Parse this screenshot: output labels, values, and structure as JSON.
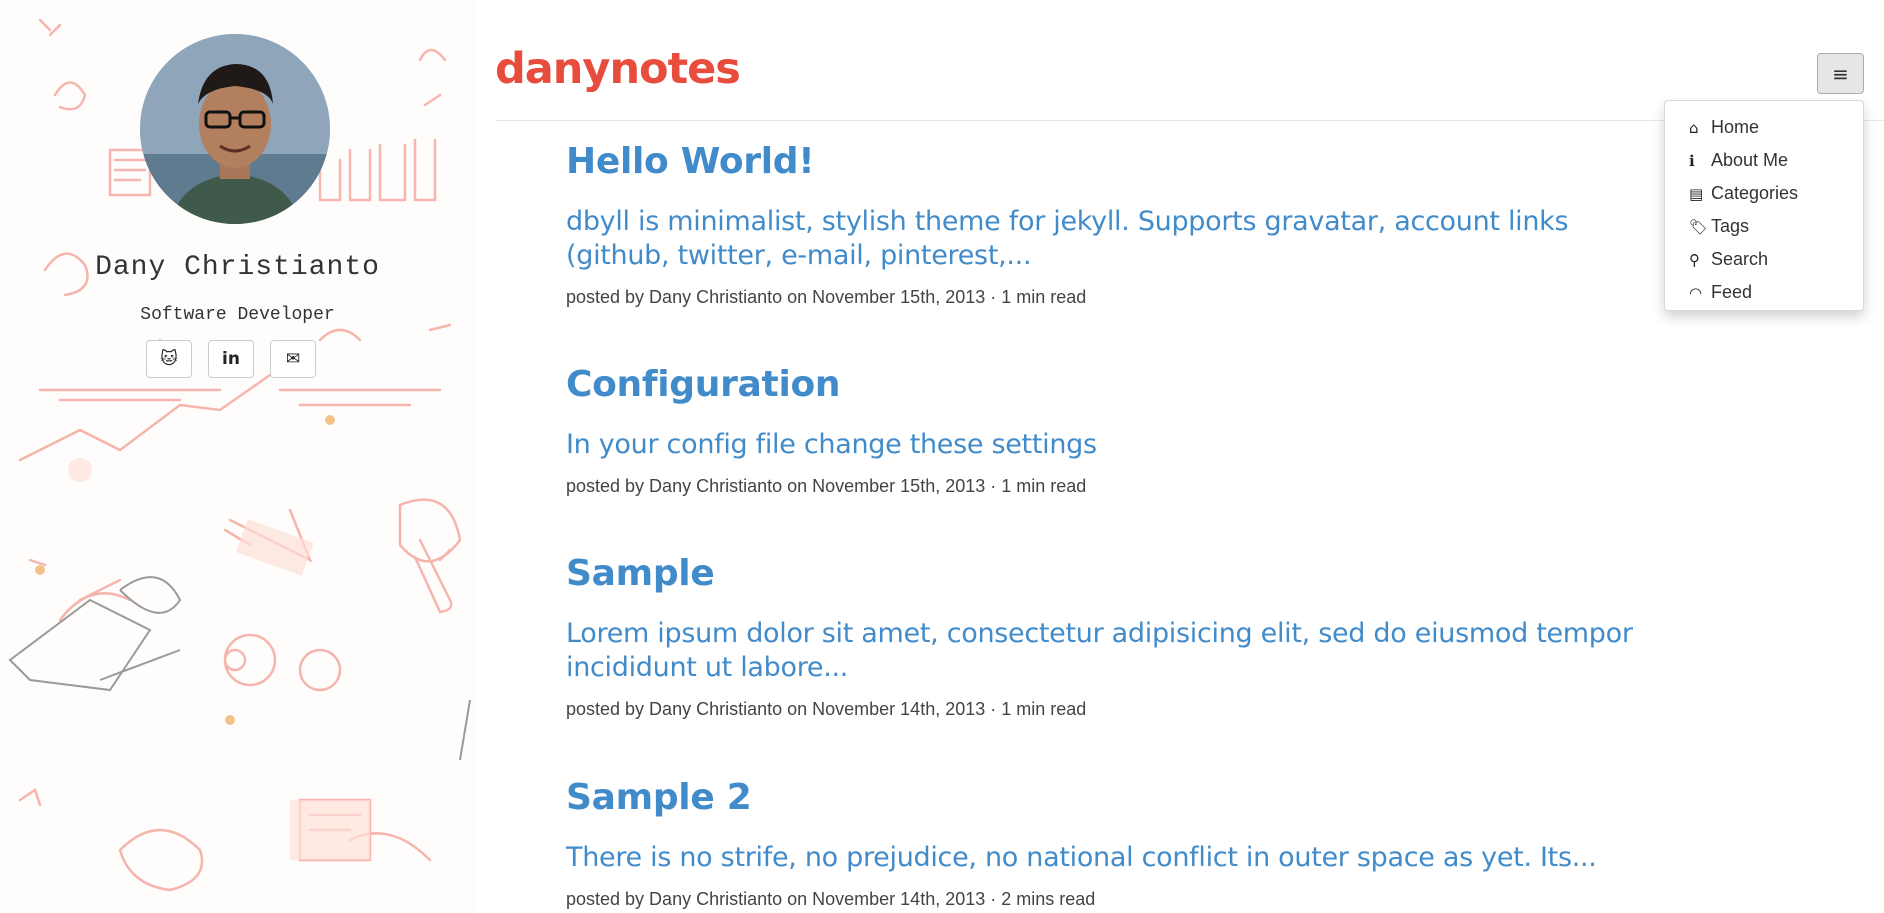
{
  "site": {
    "title": "danynotes"
  },
  "author": {
    "name": "Dany Christianto",
    "role": "Software Developer"
  },
  "social": [
    {
      "icon": "github-icon",
      "glyph": "🐱"
    },
    {
      "icon": "linkedin-icon",
      "glyph": "in"
    },
    {
      "icon": "envelope-icon",
      "glyph": "✉"
    }
  ],
  "menu": {
    "toggle_glyph": "≡",
    "items": [
      {
        "label": "Home",
        "icon": "home-icon",
        "glyph": "⌂"
      },
      {
        "label": "About Me",
        "icon": "info-circle-icon",
        "glyph": "ℹ"
      },
      {
        "label": "Categories",
        "icon": "list-icon",
        "glyph": "▤"
      },
      {
        "label": "Tags",
        "icon": "tags-icon",
        "glyph": "🏷"
      },
      {
        "label": "Search",
        "icon": "search-icon",
        "glyph": "⚲"
      },
      {
        "label": "Feed",
        "icon": "rss-icon",
        "glyph": "◠"
      }
    ]
  },
  "posts": [
    {
      "title": "Hello World!",
      "subtitle": "dbyll is minimalist, stylish theme for jekyll. Supports gravatar, account links (github, twitter, e-mail, pinterest,...",
      "meta": "posted by Dany Christianto on November 15th, 2013 · 1 min read"
    },
    {
      "title": "Configuration",
      "subtitle": "In your config file change these settings",
      "meta": "posted by Dany Christianto on November 15th, 2013 · 1 min read"
    },
    {
      "title": "Sample",
      "subtitle": "Lorem ipsum dolor sit amet, consectetur adipisicing elit, sed do eiusmod tempor incididunt ut labore...",
      "meta": "posted by Dany Christianto on November 14th, 2013 · 1 min read"
    },
    {
      "title": "Sample 2",
      "subtitle": "There is no strife, no prejudice, no national conflict in outer space as yet. Its...",
      "meta": "posted by Dany Christianto on November 14th, 2013 · 2 mins read"
    }
  ],
  "colors": {
    "brand": "#e74c3c",
    "link": "#428bca",
    "doodle": "#f4a9a0"
  }
}
